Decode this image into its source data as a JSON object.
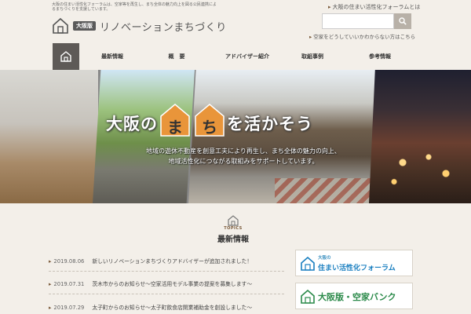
{
  "header": {
    "tagline": "大阪の住まい活性化フォーラムは、空家等を再生し、まち全体の魅力向上を図る公民連携によるまちづくりを支援しています。",
    "logo_badge": "大阪版",
    "logo_text": "リノベーションまちづくり",
    "link_forum": "大阪の住まい活性化フォーラムとは",
    "search_placeholder": "",
    "link_vacant": "空家をどうしていいかわからない方はこちら"
  },
  "nav": {
    "items": [
      {
        "label": "最新情報"
      },
      {
        "label": "概　要"
      },
      {
        "label": "アドバイザー紹介"
      },
      {
        "label": "取組事例"
      },
      {
        "label": "参考情報"
      }
    ]
  },
  "hero": {
    "title_pre": "大阪の",
    "title_ma": "ま",
    "title_chi": "ち",
    "title_post": "を活かそう",
    "subtitle_1": "地域の遊休不動産を創意工夫により再生し、まち全体の魅力の向上、",
    "subtitle_2": "地域活性化につながる取組みをサポートしています。",
    "house_color": "#e9953a"
  },
  "topics": {
    "label": "TOPICS",
    "heading": "最新情報",
    "news": [
      {
        "date": "2019.08.06",
        "text": "新しいリノベーションまちづくりアドバイザーが追加されました！"
      },
      {
        "date": "2019.07.31",
        "text": "茨木市からのお知らせ～空家活用モデル事業の提案を募集します～"
      },
      {
        "date": "2019.07.29",
        "text": "太子町からのお知らせ～太子町飲食店開業補助金を創設しました～"
      }
    ]
  },
  "banners": {
    "forum_small": "大阪の",
    "forum_big": "住まい活性化フォーラム",
    "bank": "大阪版・空家バンク"
  },
  "colors": {
    "accent_brown": "#7a5a3a",
    "nav_home_bg": "#5e5a57",
    "forum_blue": "#1a7fc0",
    "bank_green": "#2b8a4a"
  }
}
